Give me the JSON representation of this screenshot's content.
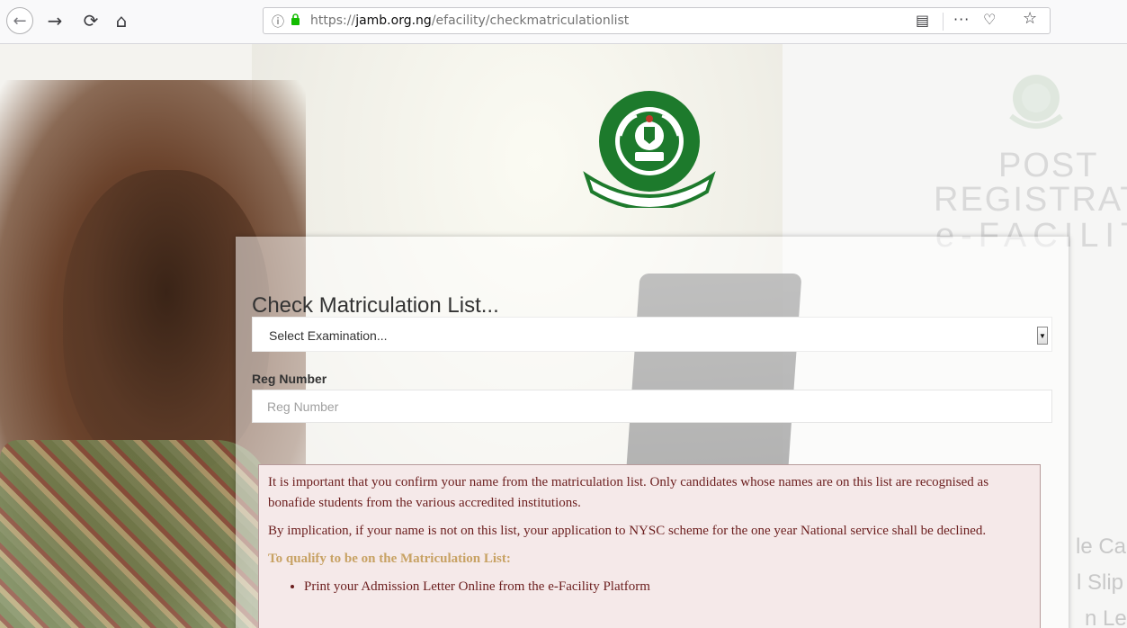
{
  "browser": {
    "nav": {
      "back_icon": "←",
      "forward_icon": "→",
      "reload_icon": "⟳",
      "home_icon": "⌂"
    },
    "url": {
      "prefix": "https://",
      "host": "jamb.org.ng",
      "path": "/efacility/checkmatriculationlist"
    },
    "icons": {
      "info": "ⓘ",
      "reader": "▤",
      "more": "···",
      "pocket": "♡",
      "star": "☆"
    }
  },
  "page": {
    "watermark": {
      "post": "POST",
      "registration": "REGISTRATIC",
      "efacility": "e-FACILIT",
      "side_card": "le Card",
      "side_slip": "l Slip Pri",
      "side_letter": "n Letter"
    },
    "form": {
      "title": "Check Matriculation List...",
      "select_value": "Select Examination...",
      "reg_label": "Reg Number",
      "reg_placeholder": "Reg Number"
    },
    "notice": {
      "p1": "It is important that you confirm your name from the matriculation list. Only candidates whose names are on this list are recognised as bonafide students from the various accredited institutions.",
      "p2": "By implication, if your name is not on this list, your application to NYSC scheme for the one year National service shall be declined.",
      "qualify": "To qualify to be on the Matriculation List:",
      "items": [
        "Print your Admission Letter Online from the e-Facility Platform"
      ]
    },
    "colors": {
      "jamb_green": "#1d7a2c",
      "notice_bg": "#f5e9e9",
      "notice_text": "#6b1e1e",
      "qualify_text": "#c8a264"
    }
  }
}
